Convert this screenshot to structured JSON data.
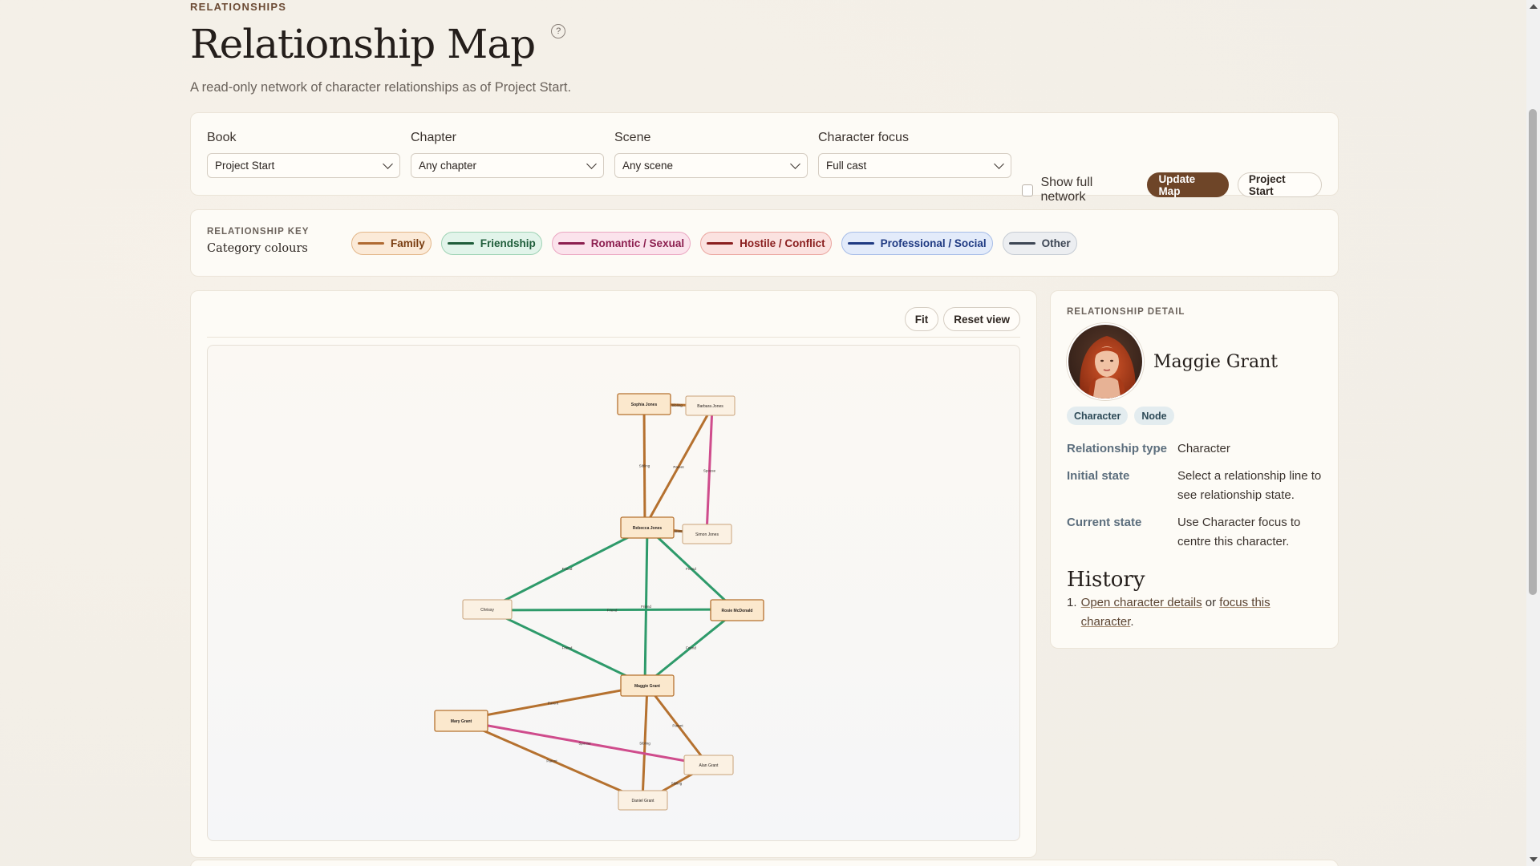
{
  "header": {
    "eyebrow": "RELATIONSHIPS",
    "title": "Relationship Map",
    "help": "?",
    "subtitle": "A read-only network of character relationships as of Project Start."
  },
  "filters": {
    "book": {
      "label": "Book",
      "value": "Project Start"
    },
    "chapter": {
      "label": "Chapter",
      "value": "Any chapter"
    },
    "scene": {
      "label": "Scene",
      "value": "Any scene"
    },
    "focus": {
      "label": "Character focus",
      "value": "Full cast"
    },
    "show_full": {
      "label": "Show full network",
      "checked": false
    },
    "update_label": "Update Map",
    "project_label": "Project Start"
  },
  "key": {
    "eyebrow": "RELATIONSHIP KEY",
    "subtitle": "Category colours",
    "chips": [
      {
        "label": "Family",
        "color": "#b06a32",
        "bg": "#fbead8",
        "border": "#e3b78a",
        "text": "#7a3e12"
      },
      {
        "label": "Friendship",
        "color": "#1f5d3a",
        "bg": "#e2f4ea",
        "border": "#9fd3b5",
        "text": "#1f5d3a"
      },
      {
        "label": "Romantic / Sexual",
        "color": "#8c1f4f",
        "bg": "#fbe3ec",
        "border": "#eba7c2",
        "text": "#8c1f4f"
      },
      {
        "label": "Hostile / Conflict",
        "color": "#8a1f1f",
        "bg": "#fbe2e0",
        "border": "#eba6a0",
        "text": "#8a1f1f"
      },
      {
        "label": "Professional / Social",
        "color": "#1f3a82",
        "bg": "#e3ebfa",
        "border": "#a7bde8",
        "text": "#1f3a82"
      },
      {
        "label": "Other",
        "color": "#3d4654",
        "bg": "#eceef1",
        "border": "#c6ccd4",
        "text": "#3d4654"
      }
    ]
  },
  "graph": {
    "fit_label": "Fit",
    "reset_label": "Reset view",
    "colors": {
      "family": "#b5712f",
      "friendship": "#2e9a6a",
      "romantic": "#cf4c8c"
    },
    "nodes": {
      "sophie": "Sophia Jones",
      "barbara": "Barbara Jones",
      "rebecca": "Rebecca Jones",
      "simon": "Simon Jones",
      "chrissy": "Chrissy",
      "rosie": "Rosie McDonald",
      "maggie": "Maggie Grant",
      "mary": "Mary Grant",
      "alan": "Alan Grant",
      "daniel": "Daniel Grant"
    },
    "edge_labels": {
      "sibling": "Sibling",
      "parent": "Parent",
      "spouse": "Spouse",
      "friend": "Friend"
    }
  },
  "detail": {
    "eyebrow": "RELATIONSHIP DETAIL",
    "name": "Maggie Grant",
    "tags": [
      "Character",
      "Node"
    ],
    "rows": [
      {
        "term": "Relationship type",
        "desc": "Character"
      },
      {
        "term": "Initial state",
        "desc": "Select a relationship line to see relationship state."
      },
      {
        "term": "Current state",
        "desc": "Use Character focus to centre this character."
      }
    ],
    "history_title": "History",
    "history_num": "1.",
    "history_link1": "Open character details",
    "history_or": " or ",
    "history_link2": "focus this character",
    "history_end": "."
  }
}
